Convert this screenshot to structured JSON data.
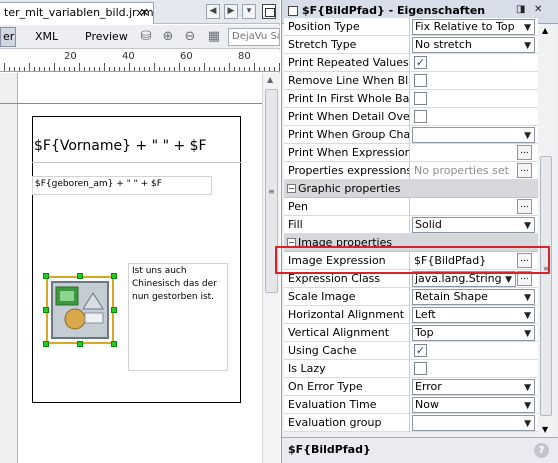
{
  "editor": {
    "tab_label": "ter_mit_variablen_bild.jrxml",
    "toolbar": {
      "designer_label": "er",
      "xml_label": "XML",
      "preview_label": "Preview",
      "font_value": "DejaVu Sa"
    },
    "ruler_labels": [
      "20",
      "40",
      "60",
      "80"
    ]
  },
  "report": {
    "vorname_expr": "$F{Vorname} + \" \" + $F",
    "geboren_expr": "$F{geboren_am} + \" \" + $F",
    "text_static": "Ist uns auch Chinesisch das der nun gestorben ist."
  },
  "properties": {
    "title": "$F{BildPfad} - Eigenschaften",
    "footer_title": "$F{BildPfad}",
    "rows": [
      {
        "type": "prop",
        "label": "Position Type",
        "kind": "combo",
        "value": "Fix Relative to Top"
      },
      {
        "type": "prop",
        "label": "Stretch Type",
        "kind": "combo",
        "value": "No stretch"
      },
      {
        "type": "prop",
        "label": "Print Repeated Values",
        "kind": "check",
        "checked": true
      },
      {
        "type": "prop",
        "label": "Remove Line When Blank",
        "kind": "check",
        "checked": false
      },
      {
        "type": "prop",
        "label": "Print In First Whole Band",
        "kind": "check",
        "checked": false
      },
      {
        "type": "prop",
        "label": "Print When Detail Overflows",
        "kind": "check",
        "checked": false
      },
      {
        "type": "prop",
        "label": "Print When Group Changes",
        "kind": "combo",
        "value": ""
      },
      {
        "type": "prop",
        "label": "Print When Expression",
        "kind": "dots",
        "value": ""
      },
      {
        "type": "prop",
        "label": "Properties expressions",
        "kind": "dots",
        "value": "No properties set",
        "gray": true
      },
      {
        "type": "category",
        "label": "Graphic properties"
      },
      {
        "type": "prop",
        "label": "Pen",
        "kind": "dots",
        "value": ""
      },
      {
        "type": "prop",
        "label": "Fill",
        "kind": "combo",
        "value": "Solid"
      },
      {
        "type": "category",
        "label": "Image properties"
      },
      {
        "type": "prop",
        "label": "Image Expression",
        "kind": "dots",
        "value": "$F{BildPfad}"
      },
      {
        "type": "prop",
        "label": "Expression Class",
        "kind": "combo-dots",
        "value": "java.lang.String"
      },
      {
        "type": "prop",
        "label": "Scale Image",
        "kind": "combo",
        "value": "Retain Shape"
      },
      {
        "type": "prop",
        "label": "Horizontal Alignment",
        "kind": "combo",
        "value": "Left"
      },
      {
        "type": "prop",
        "label": "Vertical Alignment",
        "kind": "combo",
        "value": "Top"
      },
      {
        "type": "prop",
        "label": "Using Cache",
        "kind": "check",
        "checked": true
      },
      {
        "type": "prop",
        "label": "Is Lazy",
        "kind": "check",
        "checked": false
      },
      {
        "type": "prop",
        "label": "On Error Type",
        "kind": "combo",
        "value": "Error"
      },
      {
        "type": "prop",
        "label": "Evaluation Time",
        "kind": "combo",
        "value": "Now"
      },
      {
        "type": "prop",
        "label": "Evaluation group",
        "kind": "combo",
        "value": ""
      }
    ]
  },
  "colors": {
    "highlight": "#d8232a",
    "handle": "#28c828",
    "selection": "#d9a826"
  }
}
